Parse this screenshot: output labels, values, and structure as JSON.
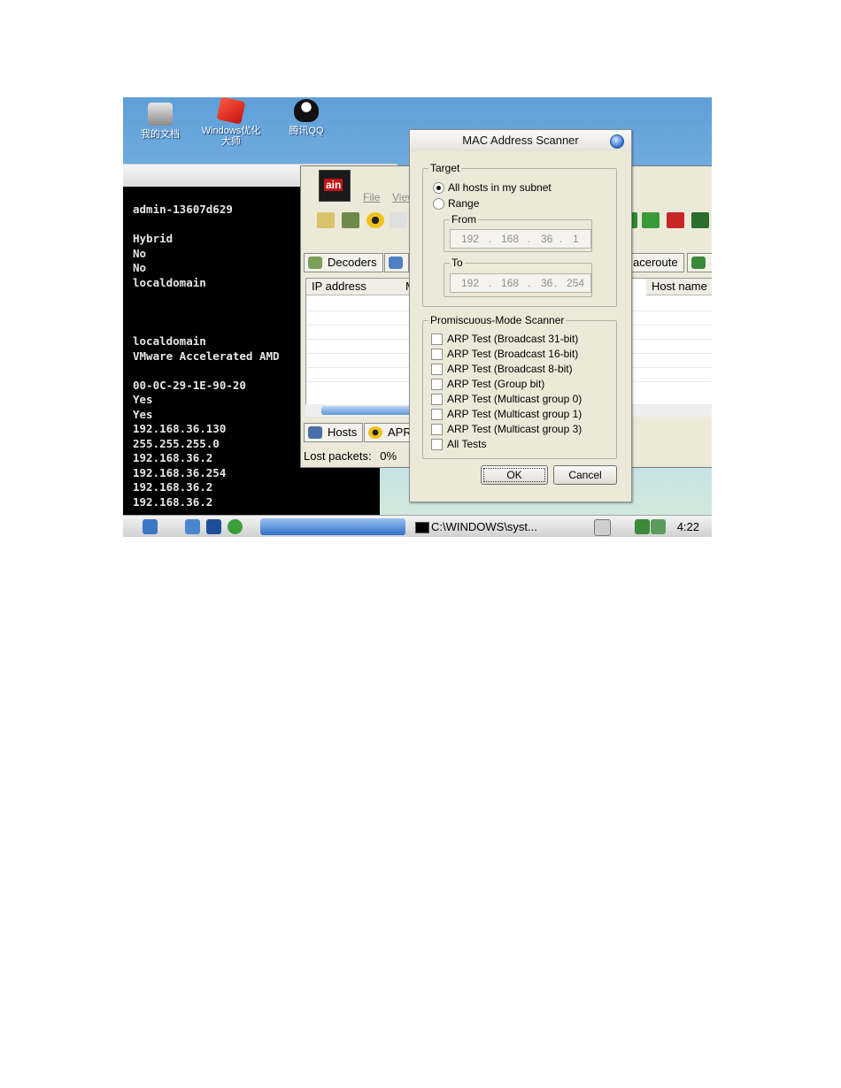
{
  "desktop": {
    "icons": [
      {
        "label": "我的文档",
        "icon": "my-documents-icon"
      },
      {
        "label": "Windows优化\n大师",
        "icon": "windows-optimizer-icon"
      },
      {
        "label": "腾讯QQ",
        "icon": "qq-icon"
      }
    ]
  },
  "console": {
    "lines": [
      "admin-13607d629",
      "Hybrid",
      "No",
      "No",
      "localdomain",
      "localdomain",
      "VMware Accelerated AMD",
      "00-0C-29-1E-90-20",
      "Yes",
      "Yes",
      "192.168.36.130",
      "255.255.255.0",
      "192.168.36.2",
      "192.168.36.254",
      "192.168.36.2",
      "192.168.36.2"
    ]
  },
  "cain": {
    "logo_text": "ain",
    "menu": [
      "File",
      "View"
    ],
    "tabs_top": [
      "Decoders",
      "aceroute"
    ],
    "columns": [
      "IP address",
      "M",
      "Host name"
    ],
    "tabs_bottom": [
      "Hosts",
      "APR"
    ],
    "status_label": "Lost packets:",
    "status_value": "0%"
  },
  "dialog": {
    "title": "MAC Address Scanner",
    "target": {
      "legend": "Target",
      "option_all": "All hosts in my subnet",
      "option_range": "Range",
      "selected": "All hosts in my subnet",
      "from_label": "From",
      "from_ip": [
        "192",
        "168",
        "36",
        "1"
      ],
      "to_label": "To",
      "to_ip": [
        "192",
        "168",
        "36",
        "254"
      ]
    },
    "promiscuous": {
      "legend": "Promiscuous-Mode Scanner",
      "tests": [
        "ARP Test (Broadcast 31-bit)",
        "ARP Test (Broadcast 16-bit)",
        "ARP Test (Broadcast 8-bit)",
        "ARP Test (Group bit)",
        "ARP Test (Multicast group 0)",
        "ARP Test (Multicast group 1)",
        "ARP Test (Multicast group 3)",
        "All Tests"
      ]
    },
    "ok_label": "OK",
    "cancel_label": "Cancel"
  },
  "taskbar": {
    "task_label": "C:\\WINDOWS\\syst...",
    "clock": "4:22"
  }
}
